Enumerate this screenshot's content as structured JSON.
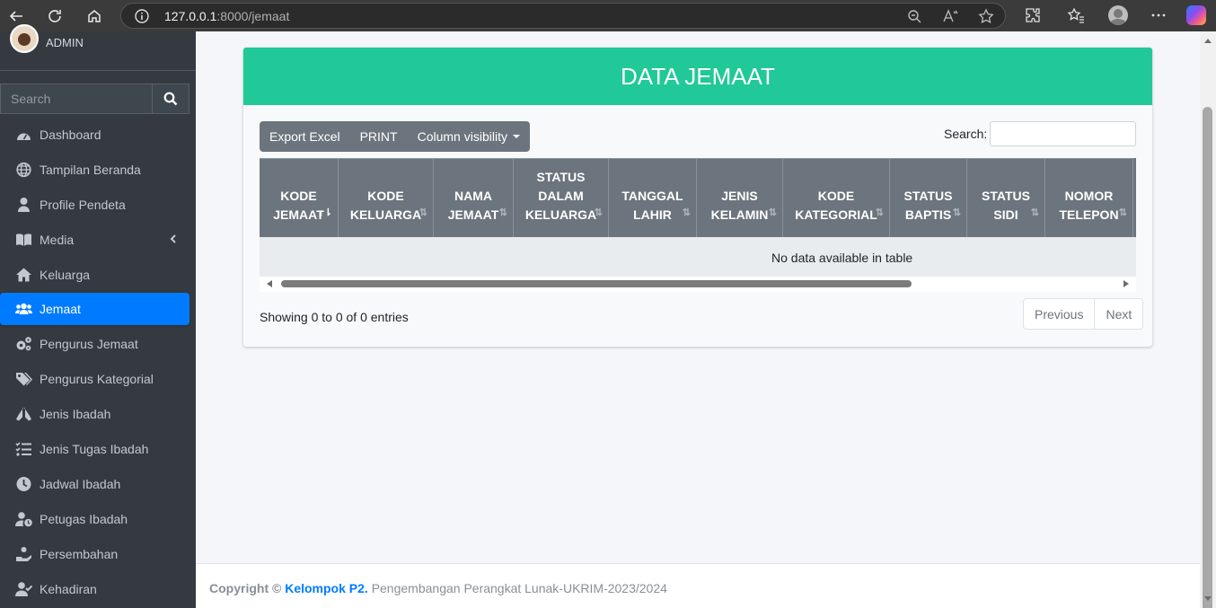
{
  "browser": {
    "url_host": "127.0.0.1",
    "url_path": ":8000/jemaat"
  },
  "sidebar": {
    "user_name": "ADMIN",
    "search_placeholder": "Search",
    "items": [
      {
        "label": "Dashboard",
        "icon": "tachometer-icon",
        "active": false
      },
      {
        "label": "Tampilan Beranda",
        "icon": "globe-icon",
        "active": false
      },
      {
        "label": "Profile Pendeta",
        "icon": "user-icon",
        "active": false
      },
      {
        "label": "Media",
        "icon": "book-icon",
        "active": false,
        "has_children": true
      },
      {
        "label": "Keluarga",
        "icon": "home-icon",
        "active": false
      },
      {
        "label": "Jemaat",
        "icon": "users-icon",
        "active": true
      },
      {
        "label": "Pengurus Jemaat",
        "icon": "cogs-icon",
        "active": false
      },
      {
        "label": "Pengurus Kategorial",
        "icon": "tags-icon",
        "active": false
      },
      {
        "label": "Jenis Ibadah",
        "icon": "praying-hands-icon",
        "active": false
      },
      {
        "label": "Jenis Tugas Ibadah",
        "icon": "tasks-icon",
        "active": false
      },
      {
        "label": "Jadwal Ibadah",
        "icon": "clock-icon",
        "active": false
      },
      {
        "label": "Petugas Ibadah",
        "icon": "user-clock-icon",
        "active": false
      },
      {
        "label": "Persembahan",
        "icon": "hand-holding-icon",
        "active": false
      },
      {
        "label": "Kehadiran",
        "icon": "user-check-icon",
        "active": false
      }
    ]
  },
  "card": {
    "title": "DATA JEMAAT",
    "buttons": [
      "Export Excel",
      "PRINT",
      "Column visibility"
    ],
    "search_label": "Search:",
    "columns": [
      {
        "lines": [
          "KODE",
          "JEMAAT"
        ],
        "sorted": true
      },
      {
        "lines": [
          "KODE",
          "KELUARGA"
        ],
        "sorted": false
      },
      {
        "lines": [
          "NAMA",
          "JEMAAT"
        ],
        "sorted": false
      },
      {
        "lines": [
          "STATUS",
          "DALAM",
          "KELUARGA"
        ],
        "sorted": false
      },
      {
        "lines": [
          "TANGGAL",
          "LAHIR"
        ],
        "sorted": false
      },
      {
        "lines": [
          "JENIS",
          "KELAMIN"
        ],
        "sorted": false
      },
      {
        "lines": [
          "KODE",
          "KATEGORIAL"
        ],
        "sorted": false
      },
      {
        "lines": [
          "STATUS",
          "BAPTIS"
        ],
        "sorted": false
      },
      {
        "lines": [
          "STATUS",
          "SIDI"
        ],
        "sorted": false
      },
      {
        "lines": [
          "NOMOR",
          "TELEPON"
        ],
        "sorted": false
      }
    ],
    "empty_message": "No data available in table",
    "info": "Showing 0 to 0 of 0 entries",
    "pagination": {
      "previous": "Previous",
      "next": "Next"
    }
  },
  "footer": {
    "copyright": "Copyright ©",
    "brand": "Kelompok P2.",
    "text": "Pengembangan Perangkat Lunak-UKRIM-2023/2024"
  },
  "colors": {
    "sidebar_bg": "#343a40",
    "active_item": "#007bff",
    "card_header": "#20c997",
    "table_header": "#6c757d"
  }
}
